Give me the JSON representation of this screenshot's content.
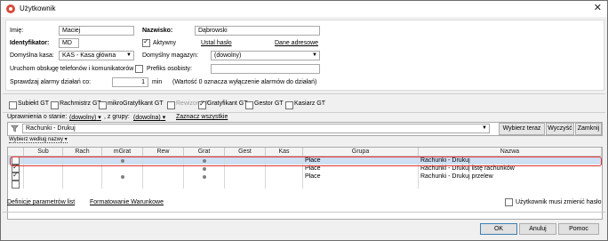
{
  "window": {
    "title": "Użytkownik",
    "close_label": "✕"
  },
  "form": {
    "imie_label": "Imię:",
    "imie_value": "Maciej",
    "nazwisko_label": "Nazwisko:",
    "nazwisko_value": "Dąbrowski",
    "identyfikator_label": "Identyfikator:",
    "identyfikator_value": "MD",
    "aktywny_label": "Aktywny",
    "aktywny_checked": true,
    "ustal_haslo_link": "Ustal hasło",
    "dane_adresowe_link": "Dane adresowe",
    "kasa_label": "Domyślna kasa:",
    "kasa_value": "KAS - Kasa główna",
    "magazyn_label": "Domyślny magazyn:",
    "magazyn_value": "(dowolny)",
    "uruchom_label": "Uruchom obsługę telefonów i komunikatorów",
    "prefiks_label": "Prefiks osobisty:",
    "prefiks_value": "",
    "alarm_label": "Sprawdzaj alarmy działań co:",
    "alarm_value": "1",
    "alarm_unit": "min",
    "alarm_note": "(Wartość 0 oznacza wyłączenie alarmów do działań)"
  },
  "roles": [
    {
      "label": "Subiekt GT",
      "checked": false,
      "disabled": false
    },
    {
      "label": "Rachmistrz GT",
      "checked": false,
      "disabled": false
    },
    {
      "label": "mikroGratyfikant GT",
      "checked": false,
      "disabled": false
    },
    {
      "label": "Rewizor GT",
      "checked": false,
      "disabled": true
    },
    {
      "label": "Gratyfikant GT",
      "checked": true,
      "disabled": false
    },
    {
      "label": "Gestor GT",
      "checked": false,
      "disabled": false
    },
    {
      "label": "Kasiarz GT",
      "checked": false,
      "disabled": false
    }
  ],
  "permissions": {
    "stan_label": "Uprawnienia o stanie:",
    "stan_value": "(dowolny)",
    "grupa_label": ", z grupy:",
    "grupa_value": "(dowolna)",
    "zaznacz_link": "Zaznacz wszystkie",
    "filter_value": "Rachunki - Drukuj",
    "btn_wybierz": "Wybierz teraz",
    "btn_wyczysc": "Wyczyść",
    "btn_zamknij": "Zamknij",
    "sort_label": "Wybierz według nazwy"
  },
  "grid": {
    "columns": [
      "Sub",
      "Rach",
      "mGrat",
      "Rew",
      "Grat",
      "Gest",
      "Kas",
      "Grupa",
      "Nazwa"
    ],
    "rows": [
      {
        "checked": false,
        "mGrat": true,
        "Grat": true,
        "grupa": "Płace",
        "nazwa": "Rachunki - Drukuj",
        "selected": true
      },
      {
        "checked": true,
        "mGrat": false,
        "Grat": true,
        "grupa": "Płace",
        "nazwa": "Rachunki - Drukuj listę rachunków",
        "selected": false
      },
      {
        "checked": true,
        "mGrat": true,
        "Grat": true,
        "grupa": "Płace",
        "nazwa": "Rachunki - Drukuj przelew",
        "selected": false
      },
      {
        "checked": false,
        "mGrat": false,
        "Grat": false,
        "grupa": "",
        "nazwa": "",
        "selected": false
      }
    ]
  },
  "footer": {
    "definicje_link": "Definicje parametrów list",
    "formatowanie_link": "Formatowanie Warunkowe",
    "zmienic_haslo_label": "Użytkownik musi zmienić hasło",
    "ok": "OK",
    "anuluj": "Anuluj",
    "pomoc": "Pomoc"
  }
}
